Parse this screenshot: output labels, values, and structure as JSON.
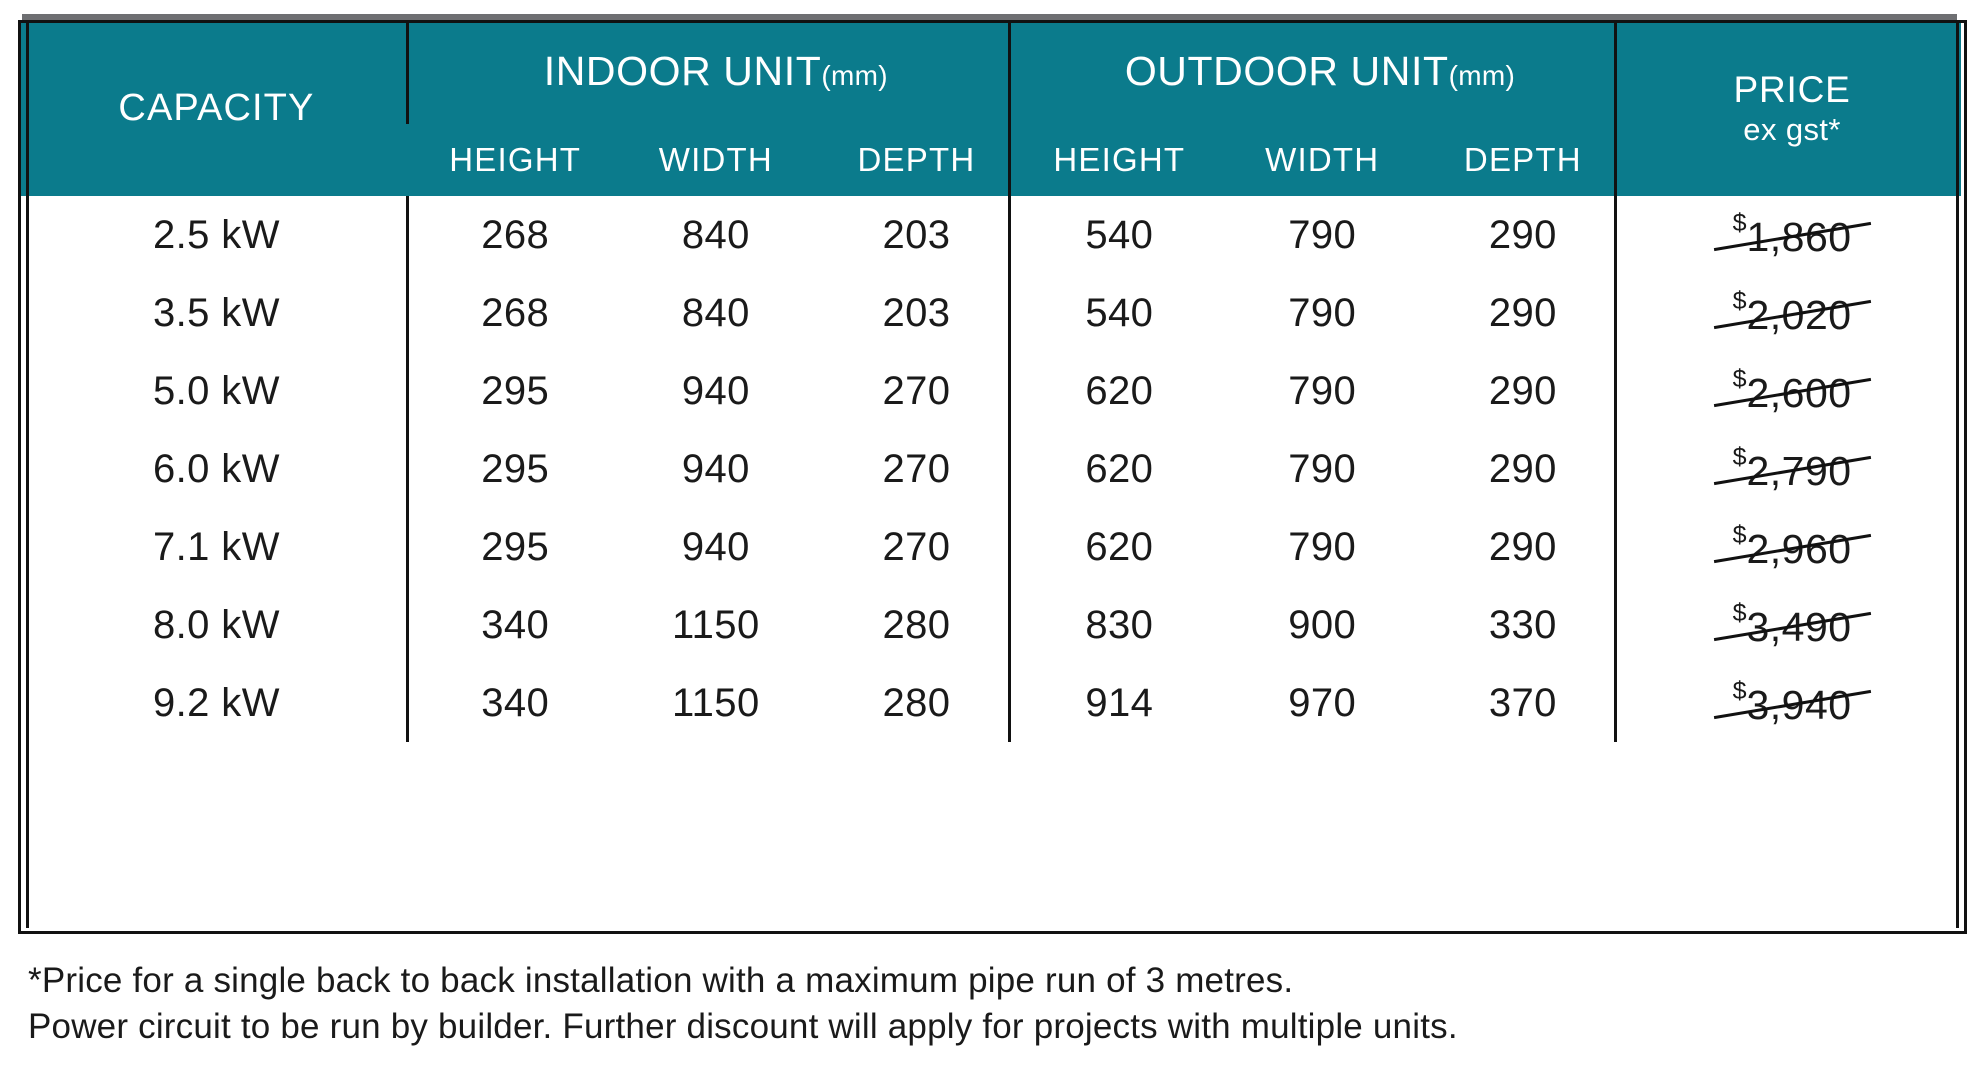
{
  "theme": {
    "header_bg": "#0b7b8c",
    "header_text": "#ffffff",
    "grid_line": "#111111",
    "top_bar": "#6e6f72",
    "body_text": "#1a1a1a"
  },
  "table": {
    "groups": {
      "capacity": "CAPACITY",
      "indoor": "INDOOR UNIT",
      "indoor_unit_suffix": "(mm)",
      "outdoor": "OUTDOOR UNIT",
      "outdoor_unit_suffix": "(mm)",
      "price": "PRICE",
      "price_sub": "ex gst*"
    },
    "subheaders": {
      "indoor_height": "HEIGHT",
      "indoor_width": "WIDTH",
      "indoor_depth": "DEPTH",
      "outdoor_height": "HEIGHT",
      "outdoor_width": "WIDTH",
      "outdoor_depth": "DEPTH"
    },
    "rows": [
      {
        "capacity": "2.5 kW",
        "indoor_height": "268",
        "indoor_width": "840",
        "indoor_depth": "203",
        "outdoor_height": "540",
        "outdoor_width": "790",
        "outdoor_depth": "290",
        "price_currency": "$",
        "price": "1,860"
      },
      {
        "capacity": "3.5 kW",
        "indoor_height": "268",
        "indoor_width": "840",
        "indoor_depth": "203",
        "outdoor_height": "540",
        "outdoor_width": "790",
        "outdoor_depth": "290",
        "price_currency": "$",
        "price": "2,020"
      },
      {
        "capacity": "5.0 kW",
        "indoor_height": "295",
        "indoor_width": "940",
        "indoor_depth": "270",
        "outdoor_height": "620",
        "outdoor_width": "790",
        "outdoor_depth": "290",
        "price_currency": "$",
        "price": "2,600"
      },
      {
        "capacity": "6.0 kW",
        "indoor_height": "295",
        "indoor_width": "940",
        "indoor_depth": "270",
        "outdoor_height": "620",
        "outdoor_width": "790",
        "outdoor_depth": "290",
        "price_currency": "$",
        "price": "2,790"
      },
      {
        "capacity": "7.1 kW",
        "indoor_height": "295",
        "indoor_width": "940",
        "indoor_depth": "270",
        "outdoor_height": "620",
        "outdoor_width": "790",
        "outdoor_depth": "290",
        "price_currency": "$",
        "price": "2,960"
      },
      {
        "capacity": "8.0 kW",
        "indoor_height": "340",
        "indoor_width": "1150",
        "indoor_depth": "280",
        "outdoor_height": "830",
        "outdoor_width": "900",
        "outdoor_depth": "330",
        "price_currency": "$",
        "price": "3,490"
      },
      {
        "capacity": "9.2 kW",
        "indoor_height": "340",
        "indoor_width": "1150",
        "indoor_depth": "280",
        "outdoor_height": "914",
        "outdoor_width": "970",
        "outdoor_depth": "370",
        "price_currency": "$",
        "price": "3,940"
      }
    ]
  },
  "footnote": {
    "line1": "*Price for a single back to back installation with a maximum pipe run of 3 metres.",
    "line2": "Power circuit to be run by builder. Further discount will apply for projects with multiple units."
  }
}
